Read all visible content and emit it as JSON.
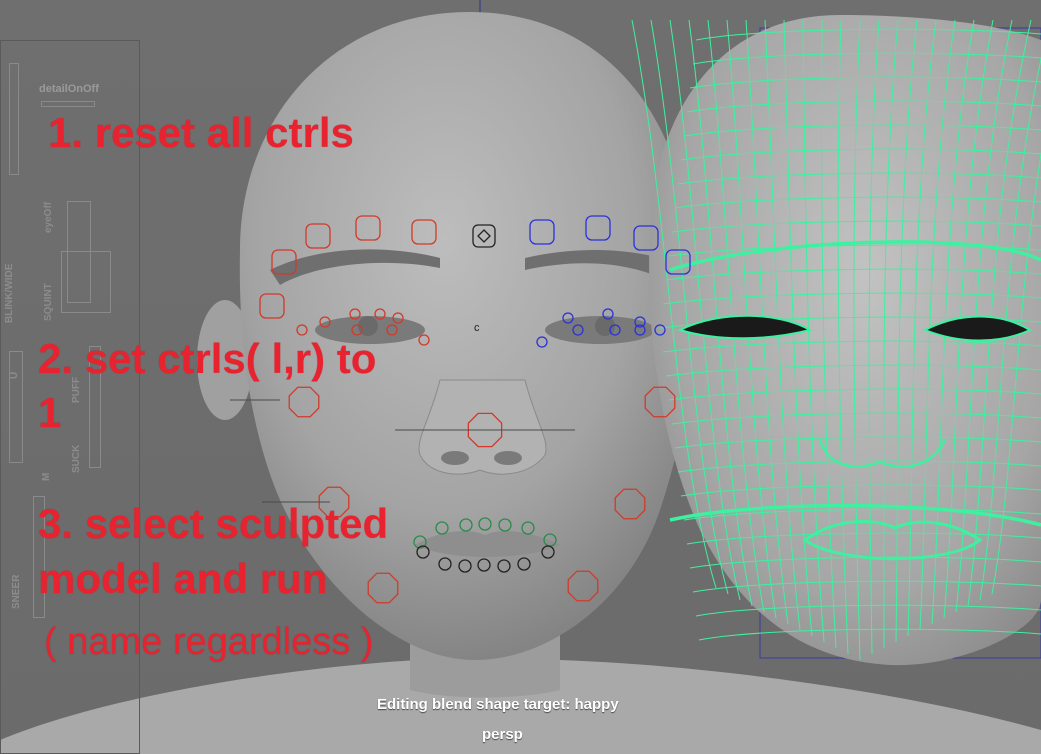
{
  "viewport": {
    "status_message": "Editing blend shape target: happy",
    "camera_name": "persp",
    "center_marker": "c"
  },
  "control_panel": {
    "detail_toggle_label": "detailOnOff",
    "labels": [
      "eyeOff",
      "BLINK/WIDE",
      "SQUINT",
      "PUFF",
      "SUCK",
      "SNEER",
      "M",
      "U"
    ]
  },
  "annotations": {
    "step1": "1. reset all ctrls",
    "step2_line1": "2. set ctrls( l,r) to",
    "step2_line2": "1",
    "step3_line1": "3. select sculpted",
    "step3_line2": "model and run",
    "step3_note": "( name regardless )"
  },
  "colors": {
    "annotation": "#e8232f",
    "wireframe": "#3ff0a0",
    "control_left": "#d03a2a",
    "control_right": "#2a32d8",
    "control_lips": "#2a8a4a"
  },
  "icons": {
    "controls": "circle-shape-icons",
    "diamond": "diamond-icon"
  }
}
